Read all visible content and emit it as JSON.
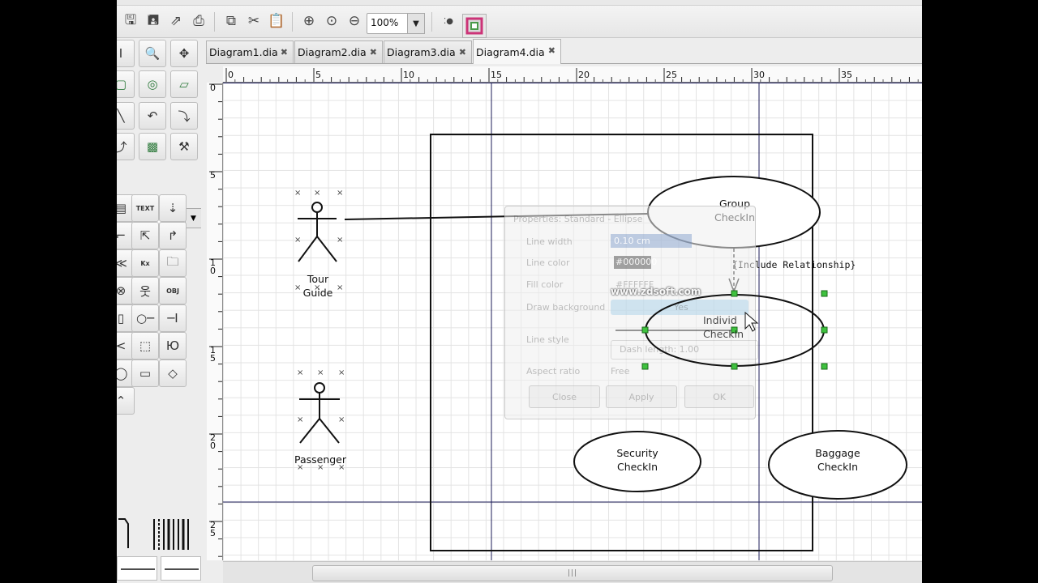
{
  "toolbar": {
    "zoom_value": "100%"
  },
  "tabs": [
    {
      "label": "Diagram1.dia"
    },
    {
      "label": "Diagram2.dia"
    },
    {
      "label": "Diagram3.dia"
    },
    {
      "label": "Diagram4.dia",
      "active": true
    }
  ],
  "rulers": {
    "horizontal_ticks": [
      "0",
      "5",
      "10",
      "15",
      "20",
      "25",
      "30",
      "35"
    ],
    "vertical_ticks": [
      "0",
      "5",
      "1 0",
      "1 5",
      "2 0",
      "2 5"
    ]
  },
  "diagram": {
    "actors": [
      {
        "name": "Tour\nGuide"
      },
      {
        "name": "Passenger"
      }
    ],
    "use_cases": [
      {
        "label": "Group\nCheckIn"
      },
      {
        "label": "Individ\nCheckIn"
      },
      {
        "label": "Security\nCheckIn"
      },
      {
        "label": "Baggage\nCheckIn"
      }
    ],
    "relationship_label": "{Include Relationship}"
  },
  "dialog": {
    "title": "Properties: Standard - Ellipse",
    "fields": [
      {
        "label": "Line width",
        "value": "0.10 cm"
      },
      {
        "label": "Line color",
        "value": "#000000"
      },
      {
        "label": "Fill color",
        "value": "#FFFFFF"
      },
      {
        "label": "Draw background",
        "value": "Yes"
      },
      {
        "label": "Line style",
        "value": "Dash length: 1.00"
      },
      {
        "label": "Aspect ratio",
        "value": "Free"
      }
    ],
    "buttons": {
      "close": "Close",
      "apply": "Apply",
      "ok": "OK"
    }
  },
  "watermark": "www.zdsoft.com",
  "colors": {
    "ui_background": "#ededed",
    "canvas": "#ffffff",
    "grid": "#e3e3e3",
    "guide_lines": "#1c1c5a",
    "handle": "#22bb22"
  }
}
